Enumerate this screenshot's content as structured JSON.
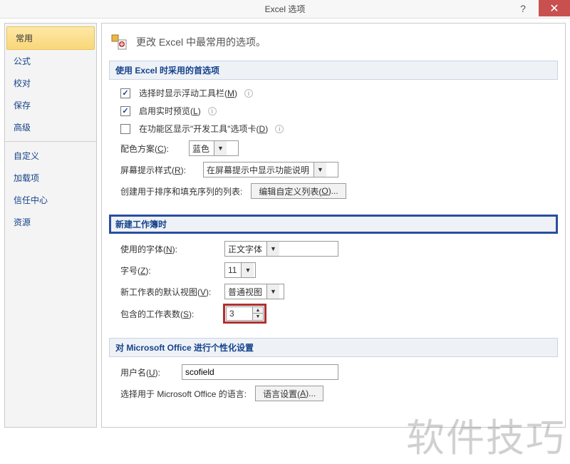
{
  "window": {
    "title": "Excel 选项",
    "help": "?",
    "close": "✕"
  },
  "sidebar": {
    "items": [
      "常用",
      "公式",
      "校对",
      "保存",
      "高级",
      "自定义",
      "加载项",
      "信任中心",
      "资源"
    ],
    "selected_index": 0
  },
  "header": {
    "icon": "⚙️",
    "text": "更改 Excel 中最常用的选项。"
  },
  "sections": {
    "prefs": {
      "title": "使用 Excel 时采用的首选项",
      "cb1": {
        "checked": true,
        "label": "选择时显示浮动工具栏(",
        "key": "M",
        "tail": ")"
      },
      "cb2": {
        "checked": true,
        "label": "启用实时预览(",
        "key": "L",
        "tail": ")"
      },
      "cb3": {
        "checked": false,
        "label": "在功能区显示\"开发工具\"选项卡(",
        "key": "D",
        "tail": ")"
      },
      "color_label": "配色方案(",
      "color_key": "C",
      "color_tail": "):",
      "color_value": "蓝色",
      "tipstyle_label": "屏幕提示样式(",
      "tipstyle_key": "R",
      "tipstyle_tail": "):",
      "tipstyle_value": "在屏幕提示中显示功能说明",
      "sortlist_label": "创建用于排序和填充序列的列表:",
      "sortlist_btn": "编辑自定义列表(",
      "sortlist_btn_key": "O",
      "sortlist_btn_tail": ")..."
    },
    "newwb": {
      "title": "新建工作簿时",
      "font_label": "使用的字体(",
      "font_key": "N",
      "font_tail": "):",
      "font_value": "正文字体",
      "size_label": "字号(",
      "size_key": "Z",
      "size_tail": "):",
      "size_value": "11",
      "view_label": "新工作表的默认视图(",
      "view_key": "V",
      "view_tail": "):",
      "view_value": "普通视图",
      "sheets_label": "包含的工作表数(",
      "sheets_key": "S",
      "sheets_tail": "):",
      "sheets_value": "3"
    },
    "personal": {
      "title": "对 Microsoft Office 进行个性化设置",
      "user_label": "用户名(",
      "user_key": "U",
      "user_tail": "):",
      "user_value": "scofield",
      "lang_label": "选择用于 Microsoft Office 的语言:",
      "lang_btn": "语言设置(",
      "lang_btn_key": "A",
      "lang_btn_tail": ")..."
    }
  },
  "watermark": "软件技巧"
}
